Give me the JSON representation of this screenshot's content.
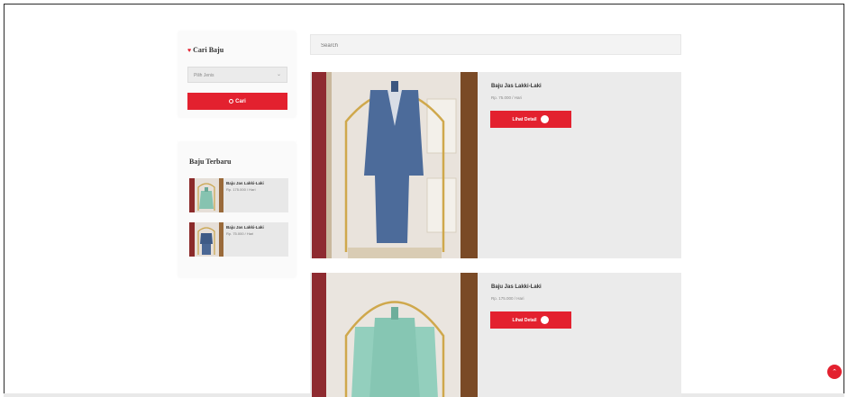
{
  "sidebar": {
    "search": {
      "title": "Cari Baju",
      "select_value": "Pilih Jenis",
      "button_label": "Cari"
    },
    "recent": {
      "title": "Baju Terbaru",
      "items": [
        {
          "name": "Baju Jas Lakki-Laki",
          "price": "Rp. 175.000 / Hari"
        },
        {
          "name": "Baju Jas Lakki-Laki",
          "price": "Rp. 75.000 / Hari"
        }
      ]
    }
  },
  "main": {
    "search_placeholder": "Search",
    "products": [
      {
        "name": "Baju Jas Lakki-Laki",
        "price": "Rp. 75.000 / Hari",
        "button_label": "Lihat Detail"
      },
      {
        "name": "Baju Jas Lakki-Laki",
        "price": "Rp. 175.000 / Hari",
        "button_label": "Lihat Detail"
      }
    ]
  },
  "colors": {
    "accent": "#e3212f",
    "card_bg": "#ebebeb"
  },
  "icons": {
    "heart": "heart-icon",
    "search": "search-icon",
    "chevron": "chevron-down-icon",
    "detail": "arrow-circle-icon",
    "fab": "chevron-up-icon"
  }
}
